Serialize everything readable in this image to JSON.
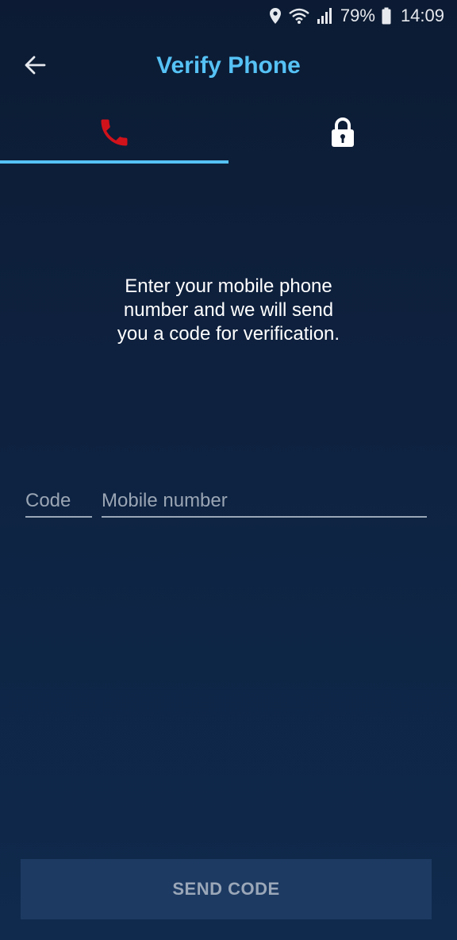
{
  "status_bar": {
    "battery": "79%",
    "time": "14:09",
    "icons": [
      "location-icon",
      "wifi-icon",
      "signal-icon",
      "battery-icon"
    ]
  },
  "header": {
    "title": "Verify Phone",
    "back_icon": "arrow-left-icon"
  },
  "tabs": [
    {
      "icon": "phone-icon",
      "active": true,
      "color": "#d0121b"
    },
    {
      "icon": "lock-icon",
      "active": false,
      "color": "#ffffff"
    }
  ],
  "instructions": {
    "line1": "Enter your mobile phone",
    "line2": "number and we will send",
    "line3": "you a code for verification."
  },
  "form": {
    "code": {
      "placeholder": "Code",
      "value": ""
    },
    "mobile": {
      "placeholder": "Mobile number",
      "value": ""
    }
  },
  "actions": {
    "send_label": "SEND CODE"
  },
  "colors": {
    "accent": "#56c2f5",
    "phone_icon": "#d0121b",
    "button_bg": "#1d3a62",
    "button_text": "#9aa7b8"
  }
}
